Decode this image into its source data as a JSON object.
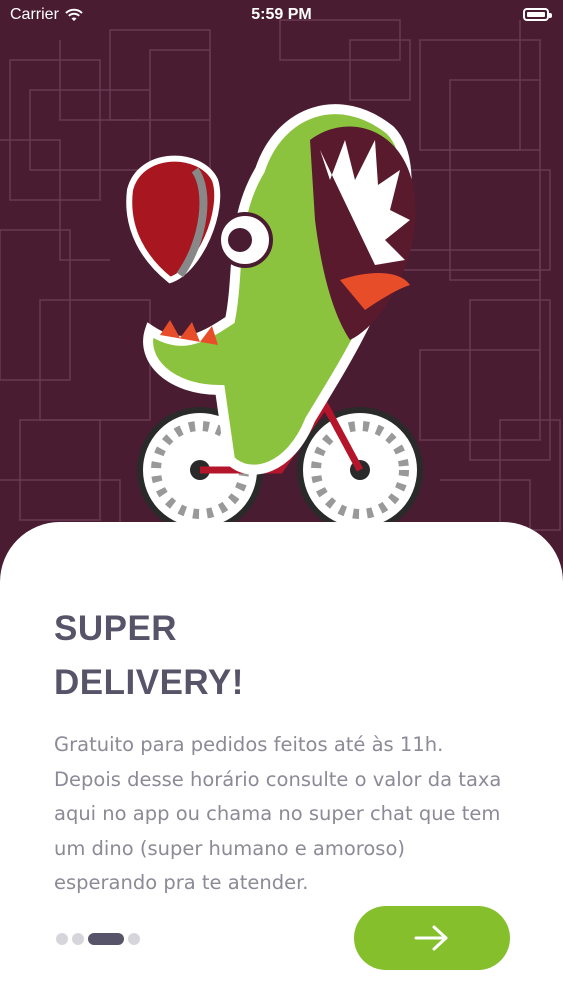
{
  "status_bar": {
    "carrier": "Carrier",
    "time": "5:59 PM"
  },
  "onboarding": {
    "title_line1": "SUPER",
    "title_line2": "DELIVERY!",
    "description_lines": [
      "Gratuito para pedidos feitos até às 11h.",
      "Depois desse horário consulte o valor da taxa",
      "aqui no app ou chama no super chat que tem",
      "um dino (super humano e amoroso)",
      "esperando pra te atender."
    ],
    "page_indicator": {
      "total": 4,
      "current": 3
    },
    "next_button_icon": "arrow-right-icon"
  },
  "colors": {
    "background": "#4a1c31",
    "accent_green": "#86bf2c",
    "title": "#57546a",
    "body_text": "#8c8a97"
  }
}
